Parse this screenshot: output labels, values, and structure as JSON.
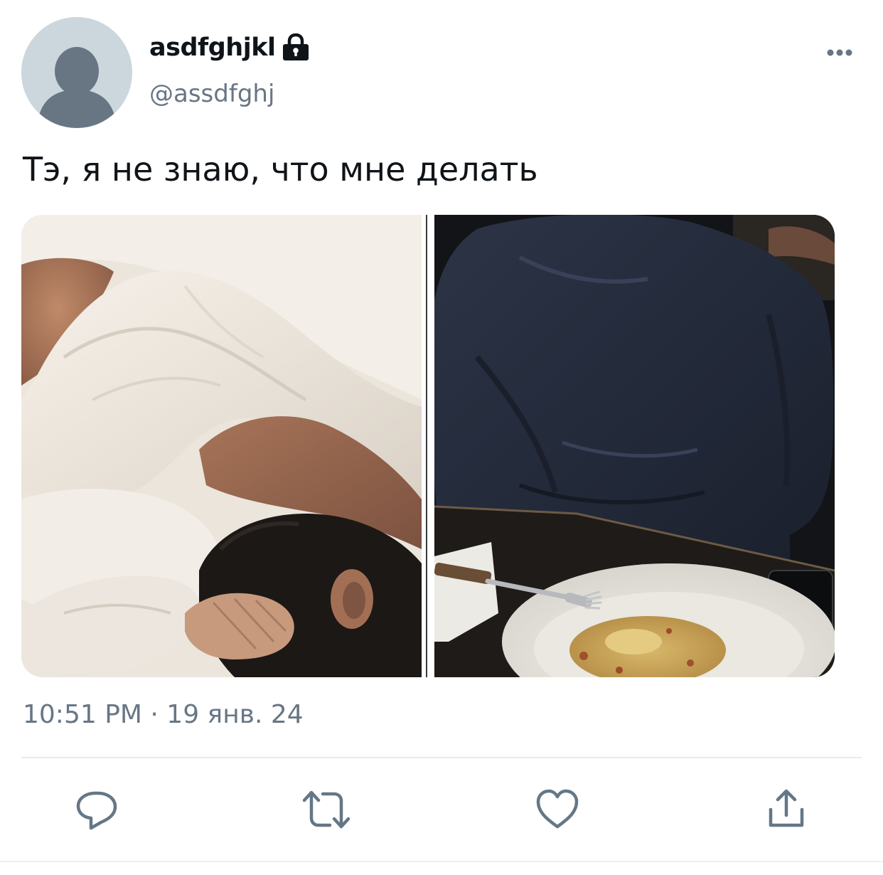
{
  "user": {
    "display_name": "asdfghjkl",
    "handle": "@assdfghj",
    "protected": true
  },
  "tweet": {
    "text": "Тэ, я не знаю, что мне делать",
    "timestamp": "10:51 PM · 19 янв. 24"
  },
  "media": [
    {
      "label": "photo-sleeping-person-under-white-sheet"
    },
    {
      "label": "photo-person-in-navy-hoodie-with-plate"
    }
  ],
  "icons": {
    "lock": "lock-icon",
    "more": "more-dots-icon",
    "reply": "reply-bubble-icon",
    "retweet": "retweet-icon",
    "like": "heart-icon",
    "share": "share-upload-icon"
  },
  "colors": {
    "text_primary": "#0f1419",
    "text_secondary": "#687684",
    "icon_gray": "#657786",
    "divider": "#e6ecf0",
    "avatar_bg": "#ccd6dd",
    "avatar_figure": "#687684"
  }
}
